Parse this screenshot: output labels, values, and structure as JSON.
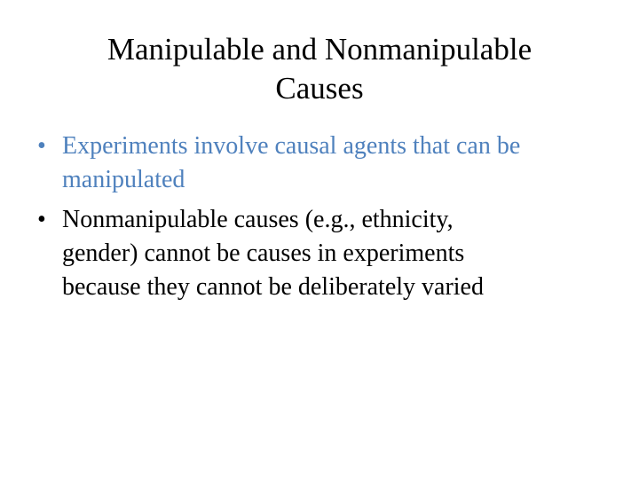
{
  "slide": {
    "title_lines": [
      "Manipulable and Nonmanipulable",
      "Causes"
    ],
    "bullets": [
      {
        "marker": "•",
        "lines": [
          "Experiments involve causal agents that can be",
          "manipulated"
        ],
        "color": "#4F81BD"
      },
      {
        "marker": "•",
        "lines": [
          "Nonmanipulable causes (e.g., ethnicity,",
          "gender) cannot be causes in experiments",
          "because they cannot be deliberately varied"
        ],
        "color": "#000000"
      }
    ]
  }
}
